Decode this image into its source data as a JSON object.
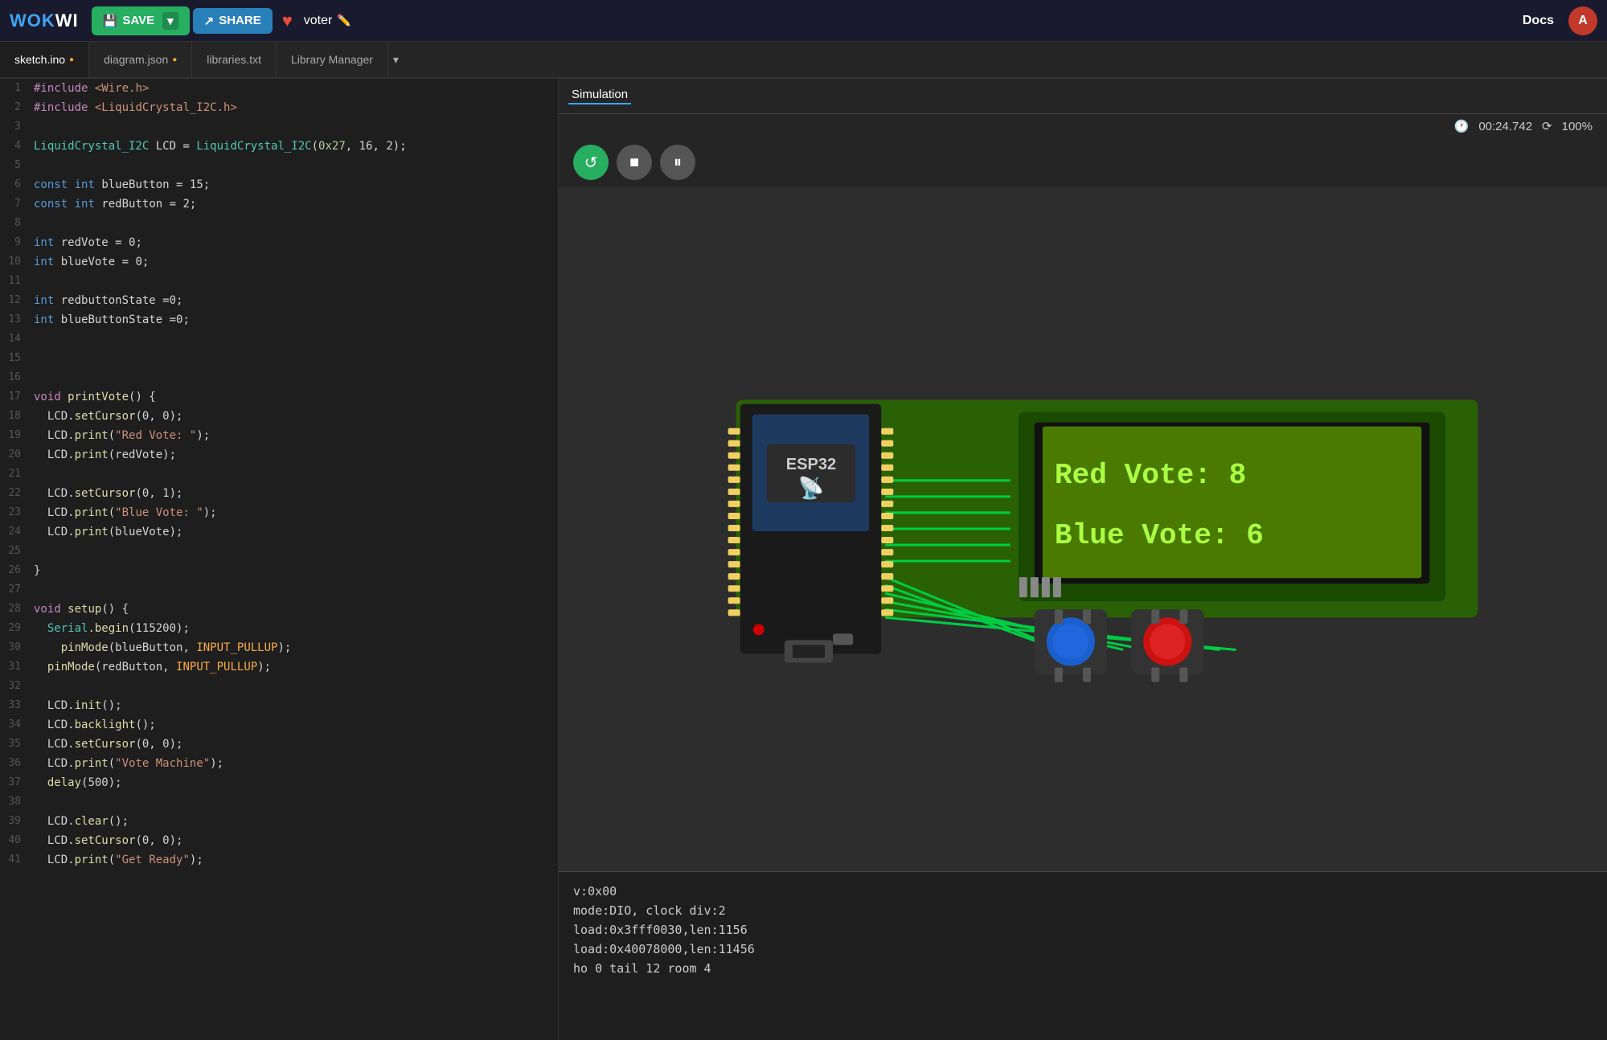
{
  "topbar": {
    "logo": "WOKWI",
    "save_label": "SAVE",
    "share_label": "SHARE",
    "username": "voter",
    "docs_label": "Docs",
    "avatar_letter": "A"
  },
  "tabs": [
    {
      "id": "sketch",
      "label": "sketch.ino",
      "modified": true,
      "active": true
    },
    {
      "id": "diagram",
      "label": "diagram.json",
      "modified": true,
      "active": false
    },
    {
      "id": "libraries",
      "label": "libraries.txt",
      "modified": false,
      "active": false
    },
    {
      "id": "libmanager",
      "label": "Library Manager",
      "modified": false,
      "active": false
    }
  ],
  "simulation": {
    "tab_label": "Simulation",
    "timer": "00:24.742",
    "speed": "100%"
  },
  "console_lines": [
    "v:0x00",
    "mode:DIO, clock div:2",
    "load:0x3fff0030,len:1156",
    "load:0x40078000,len:11456",
    "ho 0 tail 12 room 4"
  ],
  "lcd_display": {
    "line1": "Red Vote: 8",
    "line2": "Blue Vote: 6"
  },
  "code_lines": [
    {
      "num": 1,
      "tokens": [
        {
          "t": "pp",
          "v": "#include"
        },
        {
          "t": "txt",
          "v": " "
        },
        {
          "t": "str",
          "v": "<Wire.h>"
        }
      ]
    },
    {
      "num": 2,
      "tokens": [
        {
          "t": "pp",
          "v": "#include"
        },
        {
          "t": "txt",
          "v": " "
        },
        {
          "t": "str",
          "v": "<LiquidCrystal_I2C.h>"
        }
      ]
    },
    {
      "num": 3,
      "tokens": []
    },
    {
      "num": 4,
      "tokens": [
        {
          "t": "cls",
          "v": "LiquidCrystal_I2C"
        },
        {
          "t": "txt",
          "v": " LCD = "
        },
        {
          "t": "cls",
          "v": "LiquidCrystal_I2C"
        },
        {
          "t": "txt",
          "v": "("
        },
        {
          "t": "hex",
          "v": "0x27"
        },
        {
          "t": "txt",
          "v": ", 16, 2);"
        }
      ]
    },
    {
      "num": 5,
      "tokens": []
    },
    {
      "num": 6,
      "tokens": [
        {
          "t": "kw",
          "v": "const"
        },
        {
          "t": "txt",
          "v": " "
        },
        {
          "t": "kw",
          "v": "int"
        },
        {
          "t": "txt",
          "v": " blueButton = 15;"
        }
      ]
    },
    {
      "num": 7,
      "tokens": [
        {
          "t": "kw",
          "v": "const"
        },
        {
          "t": "txt",
          "v": " "
        },
        {
          "t": "kw",
          "v": "int"
        },
        {
          "t": "txt",
          "v": " redButton = 2;"
        }
      ]
    },
    {
      "num": 8,
      "tokens": []
    },
    {
      "num": 9,
      "tokens": [
        {
          "t": "kw",
          "v": "int"
        },
        {
          "t": "txt",
          "v": " redVote = 0;"
        }
      ]
    },
    {
      "num": 10,
      "tokens": [
        {
          "t": "kw",
          "v": "int"
        },
        {
          "t": "txt",
          "v": " blueVote = 0;"
        }
      ]
    },
    {
      "num": 11,
      "tokens": []
    },
    {
      "num": 12,
      "tokens": [
        {
          "t": "kw",
          "v": "int"
        },
        {
          "t": "txt",
          "v": " redbuttonState =0;"
        }
      ]
    },
    {
      "num": 13,
      "tokens": [
        {
          "t": "kw",
          "v": "int"
        },
        {
          "t": "txt",
          "v": " blueButtonState =0;"
        }
      ]
    },
    {
      "num": 14,
      "tokens": []
    },
    {
      "num": 15,
      "tokens": []
    },
    {
      "num": 16,
      "tokens": []
    },
    {
      "num": 17,
      "tokens": [
        {
          "t": "kw2",
          "v": "void"
        },
        {
          "t": "txt",
          "v": " "
        },
        {
          "t": "fn",
          "v": "printVote"
        },
        {
          "t": "txt",
          "v": "() {"
        }
      ]
    },
    {
      "num": 18,
      "tokens": [
        {
          "t": "txt",
          "v": "  LCD."
        },
        {
          "t": "fn",
          "v": "setCursor"
        },
        {
          "t": "txt",
          "v": "(0, 0);"
        }
      ]
    },
    {
      "num": 19,
      "tokens": [
        {
          "t": "txt",
          "v": "  LCD."
        },
        {
          "t": "fn",
          "v": "print"
        },
        {
          "t": "txt",
          "v": "("
        },
        {
          "t": "str",
          "v": "\"Red Vote: \""
        },
        {
          "t": "txt",
          "v": ");"
        }
      ]
    },
    {
      "num": 20,
      "tokens": [
        {
          "t": "txt",
          "v": "  LCD."
        },
        {
          "t": "fn",
          "v": "print"
        },
        {
          "t": "txt",
          "v": "(redVote);"
        }
      ]
    },
    {
      "num": 21,
      "tokens": []
    },
    {
      "num": 22,
      "tokens": [
        {
          "t": "txt",
          "v": "  LCD."
        },
        {
          "t": "fn",
          "v": "setCursor"
        },
        {
          "t": "txt",
          "v": "(0, 1);"
        }
      ]
    },
    {
      "num": 23,
      "tokens": [
        {
          "t": "txt",
          "v": "  LCD."
        },
        {
          "t": "fn",
          "v": "print"
        },
        {
          "t": "txt",
          "v": "("
        },
        {
          "t": "str",
          "v": "\"Blue Vote: \""
        },
        {
          "t": "txt",
          "v": ");"
        }
      ]
    },
    {
      "num": 24,
      "tokens": [
        {
          "t": "txt",
          "v": "  LCD."
        },
        {
          "t": "fn",
          "v": "print"
        },
        {
          "t": "txt",
          "v": "(blueVote);"
        }
      ]
    },
    {
      "num": 25,
      "tokens": []
    },
    {
      "num": 26,
      "tokens": [
        {
          "t": "txt",
          "v": "}"
        }
      ]
    },
    {
      "num": 27,
      "tokens": []
    },
    {
      "num": 28,
      "tokens": [
        {
          "t": "kw2",
          "v": "void"
        },
        {
          "t": "txt",
          "v": " "
        },
        {
          "t": "fn",
          "v": "setup"
        },
        {
          "t": "txt",
          "v": "() {"
        }
      ]
    },
    {
      "num": 29,
      "tokens": [
        {
          "t": "txt",
          "v": "  "
        },
        {
          "t": "cls",
          "v": "Serial"
        },
        {
          "t": "txt",
          "v": "."
        },
        {
          "t": "fn",
          "v": "begin"
        },
        {
          "t": "txt",
          "v": "(115200);"
        }
      ]
    },
    {
      "num": 30,
      "tokens": [
        {
          "t": "txt",
          "v": "    "
        },
        {
          "t": "fn",
          "v": "pinMode"
        },
        {
          "t": "txt",
          "v": "(blueButton, "
        },
        {
          "t": "param",
          "v": "INPUT_PULLUP"
        },
        {
          "t": "txt",
          "v": ");"
        }
      ]
    },
    {
      "num": 31,
      "tokens": [
        {
          "t": "txt",
          "v": "  "
        },
        {
          "t": "fn",
          "v": "pinMode"
        },
        {
          "t": "txt",
          "v": "(redButton, "
        },
        {
          "t": "param",
          "v": "INPUT_PULLUP"
        },
        {
          "t": "txt",
          "v": ");"
        }
      ]
    },
    {
      "num": 32,
      "tokens": []
    },
    {
      "num": 33,
      "tokens": [
        {
          "t": "txt",
          "v": "  LCD."
        },
        {
          "t": "fn",
          "v": "init"
        },
        {
          "t": "txt",
          "v": "();"
        }
      ]
    },
    {
      "num": 34,
      "tokens": [
        {
          "t": "txt",
          "v": "  LCD."
        },
        {
          "t": "fn",
          "v": "backlight"
        },
        {
          "t": "txt",
          "v": "();"
        }
      ]
    },
    {
      "num": 35,
      "tokens": [
        {
          "t": "txt",
          "v": "  LCD."
        },
        {
          "t": "fn",
          "v": "setCursor"
        },
        {
          "t": "txt",
          "v": "(0, 0);"
        }
      ]
    },
    {
      "num": 36,
      "tokens": [
        {
          "t": "txt",
          "v": "  LCD."
        },
        {
          "t": "fn",
          "v": "print"
        },
        {
          "t": "txt",
          "v": "("
        },
        {
          "t": "str",
          "v": "\"Vote Machine\""
        },
        {
          "t": "txt",
          "v": ");"
        }
      ]
    },
    {
      "num": 37,
      "tokens": [
        {
          "t": "txt",
          "v": "  "
        },
        {
          "t": "fn",
          "v": "delay"
        },
        {
          "t": "txt",
          "v": "(500);"
        }
      ]
    },
    {
      "num": 38,
      "tokens": []
    },
    {
      "num": 39,
      "tokens": [
        {
          "t": "txt",
          "v": "  LCD."
        },
        {
          "t": "fn",
          "v": "clear"
        },
        {
          "t": "txt",
          "v": "();"
        }
      ]
    },
    {
      "num": 40,
      "tokens": [
        {
          "t": "txt",
          "v": "  LCD."
        },
        {
          "t": "fn",
          "v": "setCursor"
        },
        {
          "t": "txt",
          "v": "(0, 0);"
        }
      ]
    },
    {
      "num": 41,
      "tokens": [
        {
          "t": "txt",
          "v": "  LCD."
        },
        {
          "t": "fn",
          "v": "print"
        },
        {
          "t": "txt",
          "v": "("
        },
        {
          "t": "str",
          "v": "\"Get Ready\""
        },
        {
          "t": "txt",
          "v": ");"
        }
      ]
    }
  ]
}
